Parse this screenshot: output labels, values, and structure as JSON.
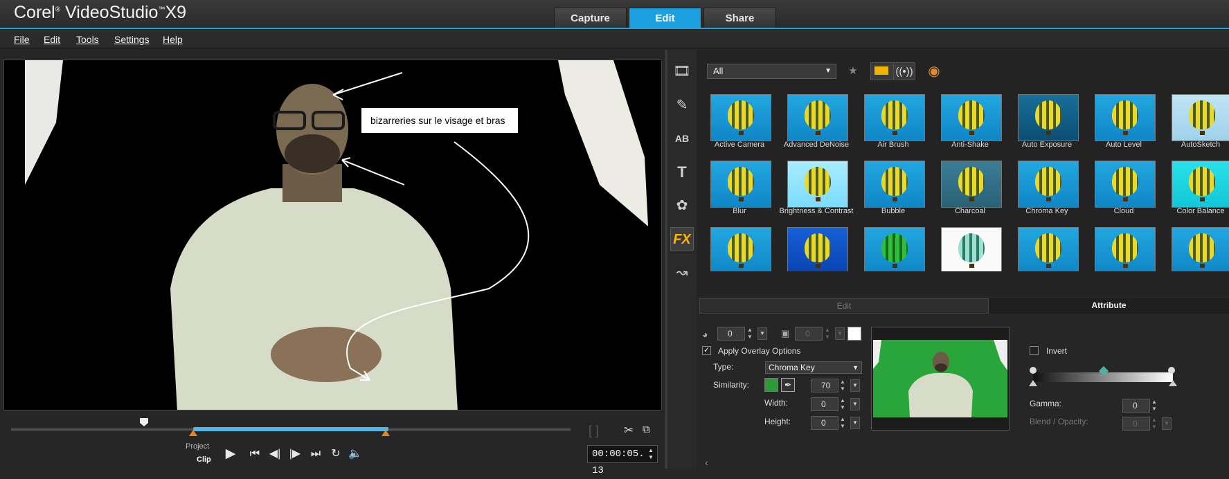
{
  "app": {
    "brand": "Corel",
    "product": "VideoStudio",
    "version": "X9",
    "tabs": [
      "Capture",
      "Edit",
      "Share"
    ],
    "active_tab": "Edit",
    "accent": "#1ba1e2"
  },
  "menu": [
    "File",
    "Edit",
    "Tools",
    "Settings",
    "Help"
  ],
  "preview": {
    "annotation": "bizarreries sur le visage et bras",
    "mode_project": "Project",
    "mode_clip": "Clip",
    "timecode": "00:00:05. 13",
    "controls": [
      "play-icon",
      "home-icon",
      "step-back-icon",
      "step-forward-icon",
      "end-icon",
      "repeat-icon",
      "volume-icon"
    ]
  },
  "library": {
    "filter": "All",
    "side_icons": [
      "media-icon",
      "instant-project-icon",
      "transition-icon",
      "title-icon",
      "graphic-icon",
      "fx-icon",
      "path-icon"
    ],
    "side_fx_label": "FX",
    "effects": [
      "Active Camera",
      "Advanced DeNoise",
      "Air Brush",
      "Anti-Shake",
      "Auto Exposure",
      "Auto Level",
      "AutoSketch",
      "Blur",
      "Brightness & Contrast",
      "Bubble",
      "Charcoal",
      "Chroma Key",
      "Cloud",
      "Color Balance",
      "",
      "",
      "",
      "",
      "",
      "",
      ""
    ]
  },
  "options": {
    "tab_edit": "Edit",
    "tab_attribute": "Attribute",
    "transparency_value": "0",
    "border_value": "0",
    "apply_overlay_label": "Apply Overlay Options",
    "type_label": "Type:",
    "type_value": "Chroma Key",
    "similarity_label": "Similarity:",
    "similarity_value": "70",
    "key_color": "#2d9a3a",
    "width_label": "Width:",
    "width_value": "0",
    "height_label": "Height:",
    "height_value": "0",
    "invert_label": "Invert",
    "gamma_label": "Gamma:",
    "gamma_value": "0",
    "blend_label": "Blend / Opacity:",
    "blend_value": "0"
  }
}
